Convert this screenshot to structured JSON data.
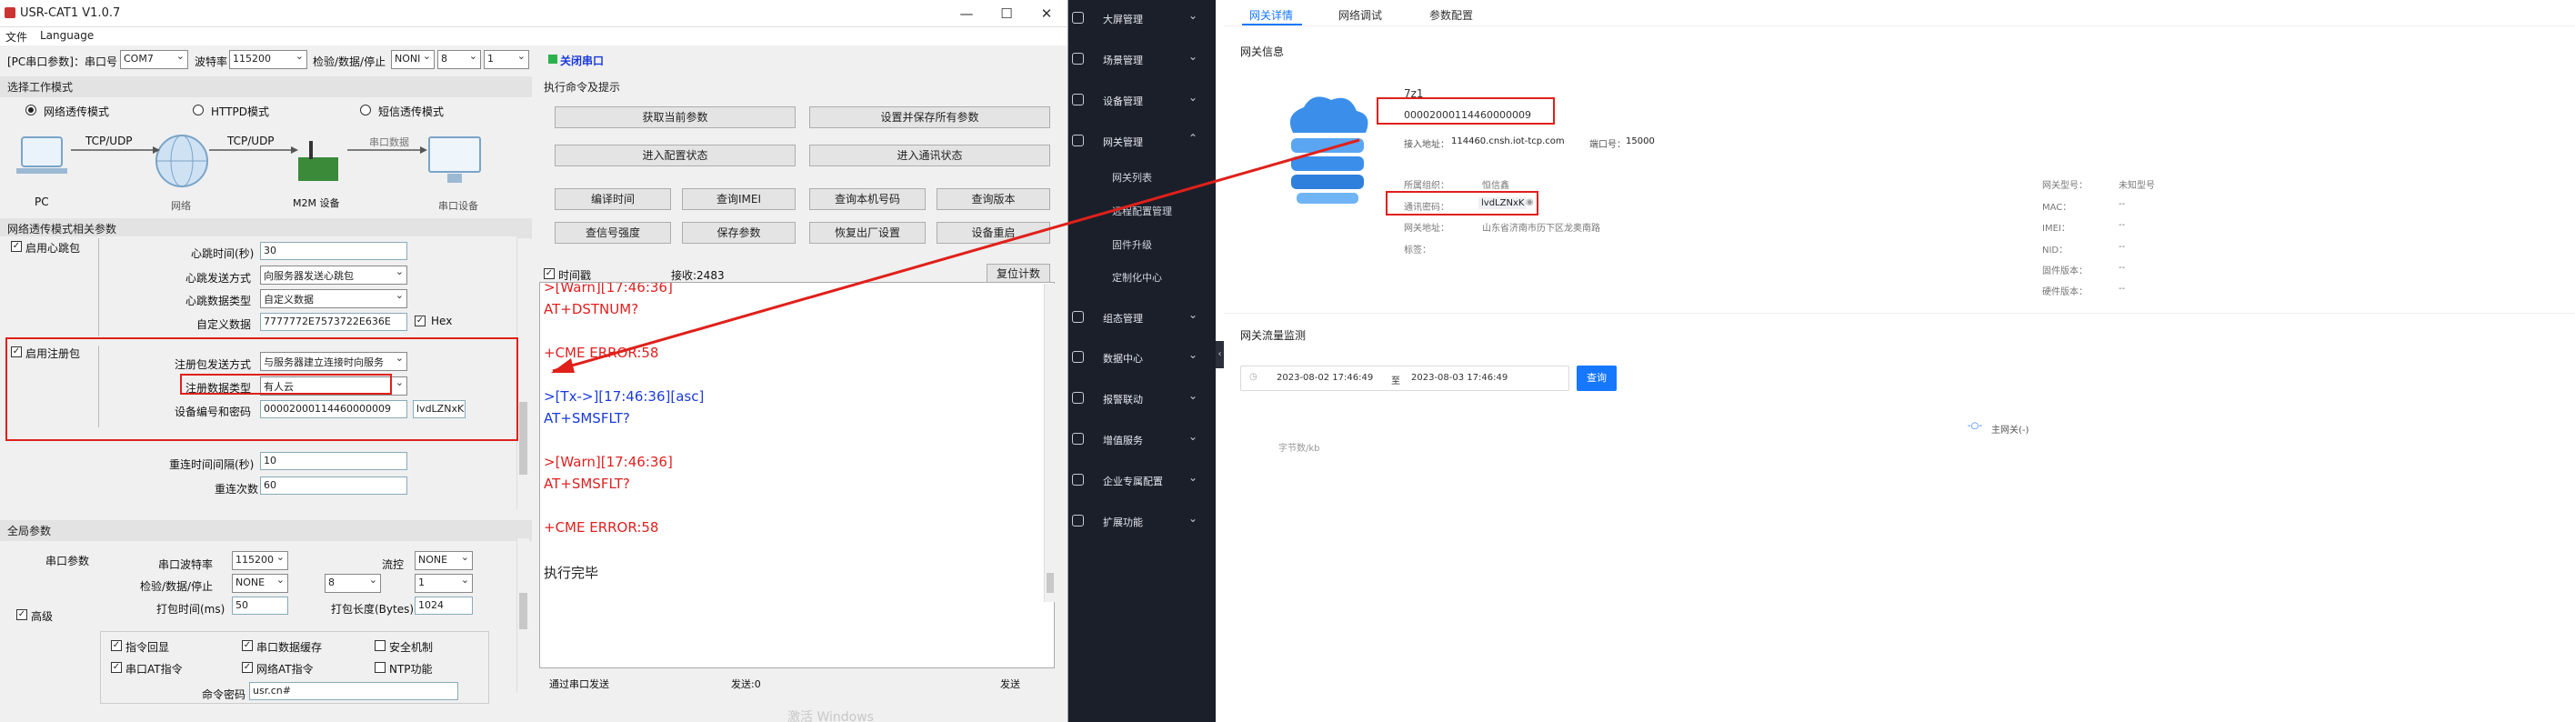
{
  "window": {
    "title": "USR-CAT1 V1.0.7",
    "minimize_icon": "—",
    "maximize_icon": "☐",
    "close_icon": "✕"
  },
  "menu": {
    "file": "文件",
    "language": "Language"
  },
  "toolbar": {
    "port_params_label": "[PC串口参数]：串口号",
    "port_value": "COM7",
    "baud_label": "波特率",
    "baud_value": "115200",
    "parity_label": "检验/数据/停止",
    "parity_value": "NONI",
    "data_bits": "8",
    "stop_bits": "1",
    "close_port_label": "关闭串口"
  },
  "work_mode": {
    "section_title": "选择工作模式",
    "modes": [
      "网络透传模式",
      "HTTPD模式",
      "短信透传模式"
    ],
    "diagram": {
      "tcp1": "TCP/UDP",
      "tcp2": "TCP/UDP",
      "serial_data": "串口数据",
      "pc": "PC",
      "network": "网络",
      "m2m": "M2M 设备",
      "serial_device": "串口设备"
    }
  },
  "net_params": {
    "section_title": "网络透传模式相关参数",
    "heartbeat_enable": "启用心跳包",
    "heartbeat_time_label": "心跳时间(秒)",
    "heartbeat_time_value": "30",
    "heartbeat_send_label": "心跳发送方式",
    "heartbeat_send_value": "向服务器发送心跳包",
    "heartbeat_type_label": "心跳数据类型",
    "heartbeat_type_value": "自定义数据",
    "custom_data_label": "自定义数据",
    "custom_data_value": "7777772E7573722E636E",
    "hex_label": "Hex",
    "register_enable": "启用注册包",
    "register_send_label": "注册包发送方式",
    "register_send_value": "与服务器建立连接时向服务",
    "register_type_label": "注册数据类型",
    "register_type_value": "有人云",
    "device_id_label": "设备编号和密码",
    "device_id_value": "00002000114460000009",
    "device_pwd_value": "lvdLZNxK",
    "reconnect_interval_label": "重连时间间隔(秒)",
    "reconnect_interval_value": "10",
    "reconnect_count_label": "重连次数",
    "reconnect_count_value": "60"
  },
  "global_params": {
    "section_title": "全局参数",
    "serial_params_label": "串口参数",
    "baud_label": "串口波特率",
    "baud_value": "115200",
    "flow_label": "流控",
    "flow_value": "NONE",
    "parity_label": "检验/数据/停止",
    "parity_value": "NONE",
    "data_bits": "8",
    "stop_bits": "1",
    "pack_time_label": "打包时间(ms)",
    "pack_time_value": "50",
    "pack_len_label": "打包长度(Bytes)",
    "pack_len_value": "1024",
    "advanced_label": "高级",
    "options": [
      "指令回显",
      "串口数据缓存",
      "安全机制",
      "串口AT指令",
      "网络AT指令",
      "NTP功能"
    ],
    "cmd_pwd_label": "命令密码",
    "cmd_pwd_value": "usr.cn#"
  },
  "commands": {
    "section_title": "执行命令及提示",
    "get_params": "获取当前参数",
    "set_save": "设置并保存所有参数",
    "enter_config": "进入配置状态",
    "enter_comm": "进入通讯状态",
    "compile_time": "编译时间",
    "query_imei": "查询IMEI",
    "query_phone": "查询本机号码",
    "query_version": "查询版本",
    "signal": "查信号强度",
    "save_params": "保存参数",
    "factory_reset": "恢复出厂设置",
    "restart": "设备重启",
    "timestamp_label": "时间戳",
    "recv_label": "接收:2483",
    "reset_count": "复位计数"
  },
  "terminal": {
    "lines": [
      ">[Warn][17:46:36]",
      "AT+DSTNUM?",
      "+CME ERROR:58",
      ">[Tx->][17:46:36][asc]",
      "AT+SMSFLT?",
      ">[Warn][17:46:36]",
      "AT+SMSFLT?",
      "+CME ERROR:58",
      "执行完毕"
    ]
  },
  "bottom_bar": {
    "send_via": "通过串口发送",
    "send_count": "发送:0",
    "send_btn": "发送",
    "watermark": "激活 Windows"
  },
  "nav": {
    "items": [
      "大屏管理",
      "场景管理",
      "设备管理",
      "网关管理",
      "组态管理",
      "数据中心",
      "报警联动",
      "增值服务",
      "企业专属配置",
      "扩展功能"
    ],
    "subitems": [
      "网关列表",
      "远程配置管理",
      "固件升级",
      "定制化中心"
    ]
  },
  "web": {
    "tabs": [
      "网关详情",
      "网络调试",
      "参数配置"
    ],
    "gateway_info_title": "网关信息",
    "gw_name": "7z1",
    "gw_sn": "00002000114460000009",
    "access_label": "接入地址：",
    "access_value": "114460.cnsh.iot-tcp.com",
    "port_label": "端口号：",
    "port_value": "15000",
    "org_label": "所属组织：",
    "org_value": "恒信鑫",
    "pwd_label": "通讯密码：",
    "pwd_value": "lvdLZNxK",
    "addr_label": "网关地址：",
    "addr_value": "山东省济南市历下区龙奥南路",
    "tag_label": "标签：",
    "type_label": "网关型号：",
    "type_value": "未知型号",
    "mac_label": "MAC：",
    "mac_value": "--",
    "imei_label": "IMEI：",
    "imei_value": "--",
    "nid_label": "NID：",
    "nid_value": "--",
    "fw_label": "固件版本：",
    "fw_value": "--",
    "hw_label": "硬件版本：",
    "hw_value": "--",
    "flow_title": "网关流量监测",
    "date_from": "2023-08-02 17:46:49",
    "date_sep": "至",
    "date_to": "2023-08-03 17:46:49",
    "query_btn": "查询",
    "legend": "主网关(-)",
    "yaxis": "字节数/kb"
  },
  "colors": {
    "accent": "#1677ff",
    "annotation": "#e0201a",
    "nav_bg": "#1b1f2a"
  }
}
